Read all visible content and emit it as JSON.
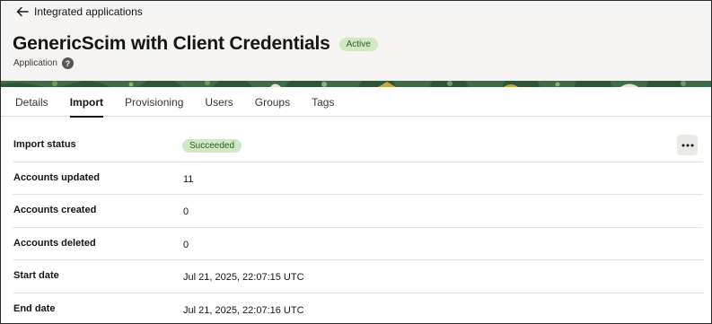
{
  "header": {
    "back_label": "Integrated applications",
    "title": "GenericScim with Client Credentials",
    "status": "Active",
    "subtitle": "Application",
    "help_glyph": "?"
  },
  "tabs": [
    {
      "label": "Details",
      "active": false
    },
    {
      "label": "Import",
      "active": true
    },
    {
      "label": "Provisioning",
      "active": false
    },
    {
      "label": "Users",
      "active": false
    },
    {
      "label": "Groups",
      "active": false
    },
    {
      "label": "Tags",
      "active": false
    }
  ],
  "import": {
    "status_label": "Import status",
    "status_value": "Succeeded",
    "updated_label": "Accounts updated",
    "updated_value": "11",
    "created_label": "Accounts created",
    "created_value": "0",
    "deleted_label": "Accounts deleted",
    "deleted_value": "0",
    "start_label": "Start date",
    "start_value": "Jul 21, 2025, 22:07:15 UTC",
    "end_label": "End date",
    "end_value": "Jul 21, 2025, 22:07:16 UTC"
  },
  "icons": {
    "back": "arrow-left-icon",
    "help": "help-icon",
    "more": "more-horizontal-icon"
  },
  "colors": {
    "badge_bg": "#d1e8c4",
    "badge_text": "#2f5b1e",
    "pattern_green": "#3f6b48",
    "pattern_gold": "#c9a43b"
  }
}
